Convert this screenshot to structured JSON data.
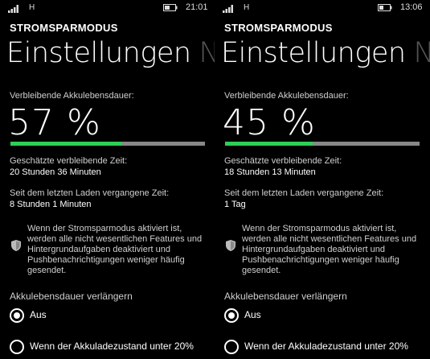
{
  "screens": [
    {
      "status_bar": {
        "network": "H",
        "time": "21:01"
      },
      "section_title": "STROMSPARMODUS",
      "pivot": {
        "active": "Einstellungen",
        "next": "Nu"
      },
      "battery_label": "Verbleibende Akkulebensdauer:",
      "battery_percent_text": "57 %",
      "battery_level": 0.57,
      "remaining_label": "Geschätzte verbleibende Zeit:",
      "remaining_value": "20 Stunden 36 Minuten",
      "since_label": "Seit dem letzten Laden vergangene Zeit:",
      "since_value": "8 Stunden 1 Minuten",
      "info_text": "Wenn der Stromsparmodus aktiviert ist, werden alle nicht wesentlichen Features und Hintergrundaufgaben deaktiviert und Pushbenachrichtigungen weniger häufig gesendet.",
      "extend_label": "Akkulebensdauer verlängern",
      "options": [
        {
          "label": "Aus",
          "checked": true
        },
        {
          "label": "Wenn der Akkuladezustand unter 20%",
          "checked": false
        }
      ]
    },
    {
      "status_bar": {
        "network": "H",
        "time": "13:06"
      },
      "section_title": "STROMSPARMODUS",
      "pivot": {
        "active": "Einstellungen",
        "next": "Nu"
      },
      "battery_label": "Verbleibende Akkulebensdauer:",
      "battery_percent_text": "45 %",
      "battery_level": 0.45,
      "remaining_label": "Geschätzte verbleibende Zeit:",
      "remaining_value": "18 Stunden 13 Minuten",
      "since_label": "Seit dem letzten Laden vergangene Zeit:",
      "since_value": "1 Tag",
      "info_text": "Wenn der Stromsparmodus aktiviert ist, werden alle nicht wesentlichen Features und Hintergrundaufgaben deaktiviert und Pushbenachrichtigungen weniger häufig gesendet.",
      "extend_label": "Akkulebensdauer verlängern",
      "options": [
        {
          "label": "Aus",
          "checked": true
        },
        {
          "label": "Wenn der Akkuladezustand unter 20%",
          "checked": false
        }
      ]
    }
  ],
  "colors": {
    "background": "#000000",
    "accent_green": "#2fcf56",
    "progress_track": "#888888",
    "text_secondary": "#cfcfcf",
    "pivot_inactive": "#555555"
  },
  "icons": {
    "signal": "signal-strength-icon",
    "battery": "battery-icon",
    "shield": "shield-icon"
  }
}
